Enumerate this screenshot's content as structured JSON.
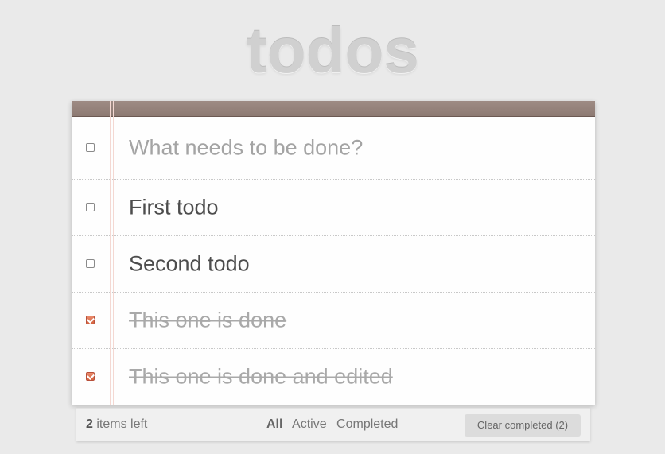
{
  "app": {
    "title": "todos"
  },
  "new_todo": {
    "placeholder": "What needs to be done?"
  },
  "todos": [
    {
      "label": "First todo",
      "completed": false
    },
    {
      "label": "Second todo",
      "completed": false
    },
    {
      "label": "This one is done",
      "completed": true
    },
    {
      "label": "This one is done and edited",
      "completed": true
    }
  ],
  "footer": {
    "count": "2",
    "count_suffix": " items left",
    "filters": {
      "all": "All",
      "active": "Active",
      "completed": "Completed",
      "selected": "All"
    },
    "clear_label": "Clear completed (2)"
  },
  "colors": {
    "topbar": "#9e8b84",
    "checked": "#d4623f"
  }
}
